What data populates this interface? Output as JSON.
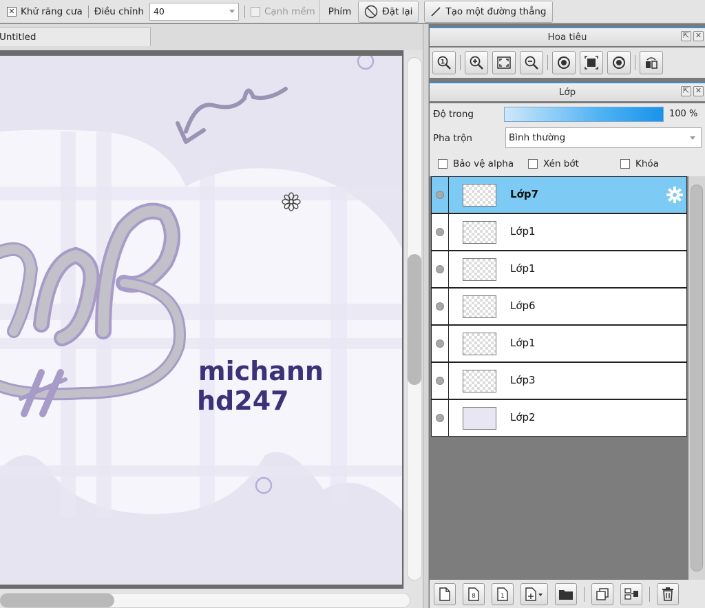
{
  "toolbar": {
    "antialias_label": "Khử răng cưa",
    "adjust_label": "Điều chỉnh",
    "adjust_value": "40",
    "soft_edge_label": "Cạnh mềm",
    "keys_label": "Phím",
    "reset_label": "Đặt lại",
    "straight_line_label": "Tạo một đường thẳng"
  },
  "document": {
    "tab_title": "Untitled"
  },
  "canvas": {
    "text_line1": "michann",
    "text_line2": "hd247",
    "colors": {
      "background": "#e6e4f0",
      "cloud": "#f6f5fb",
      "lettering": "#c2c0c8",
      "accent": "#a79bc8",
      "signature": "#3b3278"
    }
  },
  "navigator": {
    "title": "Hoa tiêu",
    "tools": [
      "zoom-actual-icon",
      "zoom-in-icon",
      "fit-screen-icon",
      "zoom-out-icon",
      "rotate-left-icon",
      "reset-view-icon",
      "rotate-right-icon",
      "flip-horizontal-icon"
    ]
  },
  "layers": {
    "title": "Lớp",
    "opacity_label": "Độ trong",
    "opacity_value": "100 %",
    "opacity_fraction": 1.0,
    "blend_label": "Pha trộn",
    "blend_value": "Bình thường",
    "protect_alpha_label": "Bảo vệ alpha",
    "clip_label": "Xén bớt",
    "lock_label": "Khóa",
    "items": [
      {
        "name": "Lớp7",
        "selected": true
      },
      {
        "name": "Lớp1",
        "selected": false
      },
      {
        "name": "Lớp1",
        "selected": false
      },
      {
        "name": "Lớp6",
        "selected": false
      },
      {
        "name": "Lớp1",
        "selected": false
      },
      {
        "name": "Lớp3",
        "selected": false
      },
      {
        "name": "Lớp2",
        "selected": false
      }
    ],
    "bottom_tools": [
      "new-layer-icon",
      "new-8bit-layer-icon",
      "new-1bit-layer-icon",
      "add-layer-menu-icon",
      "new-folder-icon",
      "duplicate-layer-icon",
      "merge-down-icon",
      "delete-layer-icon"
    ],
    "accent_color": "#7dcaf4"
  }
}
